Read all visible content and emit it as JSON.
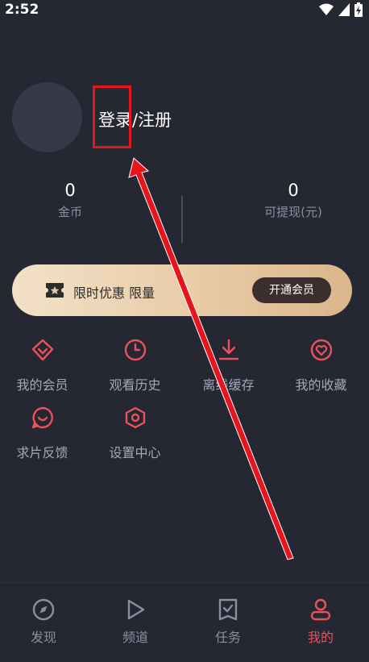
{
  "status_bar": {
    "time": "2:52"
  },
  "profile": {
    "login_label": "登录",
    "separator": "/",
    "register_label": "注册"
  },
  "stats": [
    {
      "value": "0",
      "label": "金币"
    },
    {
      "value": "0",
      "label": "可提现(元)"
    }
  ],
  "vip_banner": {
    "text": "限时优惠 限量",
    "button_label": "开通会员"
  },
  "menu": [
    {
      "label": "我的会员",
      "icon": "diamond-icon"
    },
    {
      "label": "观看历史",
      "icon": "clock-icon"
    },
    {
      "label": "离线缓存",
      "icon": "download-icon"
    },
    {
      "label": "我的收藏",
      "icon": "heart-icon"
    },
    {
      "label": "求片反馈",
      "icon": "smile-chat-icon"
    },
    {
      "label": "设置中心",
      "icon": "hexagon-settings-icon"
    }
  ],
  "tabs": [
    {
      "label": "发现",
      "icon": "compass-icon",
      "active": false
    },
    {
      "label": "频道",
      "icon": "play-icon",
      "active": false
    },
    {
      "label": "任务",
      "icon": "checklist-icon",
      "active": false
    },
    {
      "label": "我的",
      "icon": "person-icon",
      "active": true
    }
  ],
  "colors": {
    "background": "#252733",
    "accent": "#e8525c",
    "annotation": "#e8141c",
    "vip_gold": "#e8c9a4"
  }
}
